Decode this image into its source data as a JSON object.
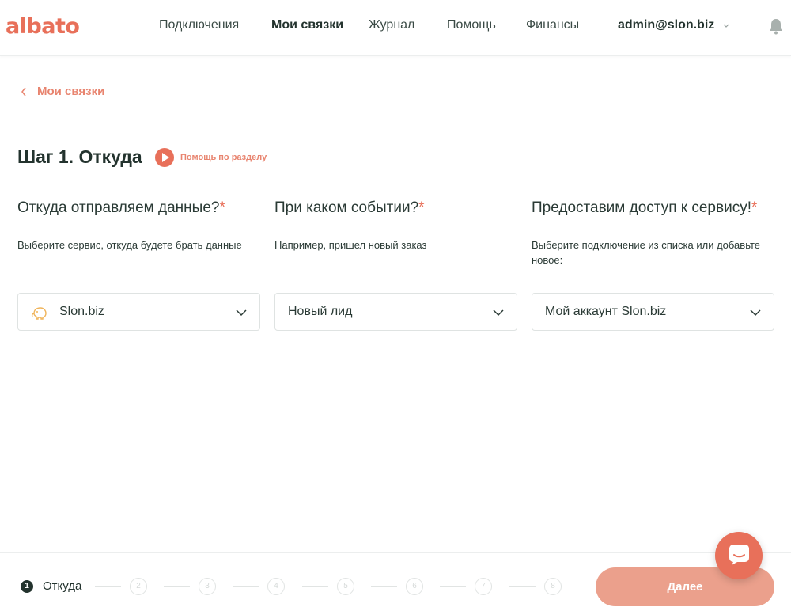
{
  "header": {
    "logo": "albato",
    "nav": [
      {
        "label": "Подключения",
        "active": false
      },
      {
        "label": "Мои связки",
        "active": true
      },
      {
        "label": "Журнал",
        "active": false
      },
      {
        "label": "Помощь",
        "active": false
      },
      {
        "label": "Финансы",
        "active": false
      }
    ],
    "user": "admin@slon.biz",
    "user_menu_icon": "chevron-down-icon",
    "notifications_icon": "bell-icon"
  },
  "breadcrumb": {
    "back_label": "Мои связки",
    "icon": "chevron-left-icon"
  },
  "step": {
    "title": "Шаг 1. Откуда",
    "help_label": "Помощь по разделу",
    "help_icon": "play-icon"
  },
  "columns": [
    {
      "title": "Откуда отправляем данные?",
      "required_mark": "*",
      "description": "Выберите сервис, откуда будете брать данные",
      "select_value": "Slon.biz",
      "select_icon": "elephant-icon"
    },
    {
      "title": "При каком событии?",
      "required_mark": "*",
      "description": "Например, пришел новый заказ",
      "select_value": "Новый лид"
    },
    {
      "title": "Предоставим доступ к сервису!",
      "required_mark": "*",
      "description": "Выберите подключение из списка или добавьте новое:",
      "select_value": "Мой аккаунт Slon.biz"
    }
  ],
  "stepper": {
    "current_number": "1",
    "current_label": "Откуда",
    "steps": [
      "2",
      "3",
      "4",
      "5",
      "6",
      "7",
      "8"
    ]
  },
  "next_button": "Далее",
  "chat_icon": "chat-icon",
  "colors": {
    "accent": "#e8705a",
    "accent_light": "#eba08c",
    "text_dark": "#23332e"
  }
}
